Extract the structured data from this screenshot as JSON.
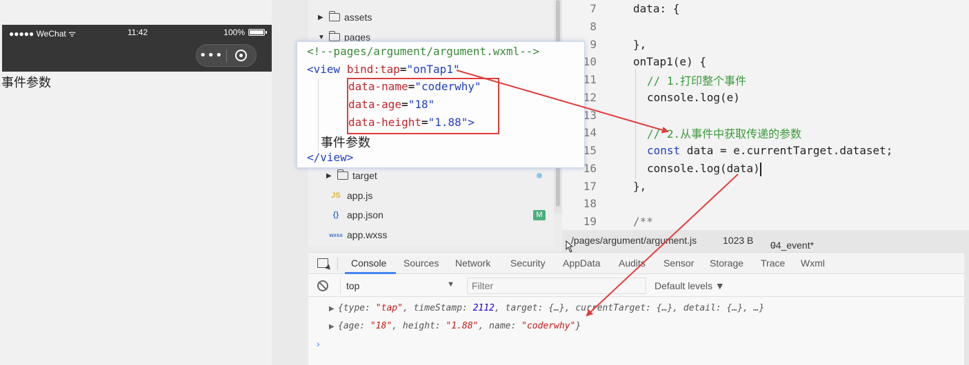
{
  "simulator": {
    "carrier": "●●●●● WeChat",
    "wifi_icon": "wifi-icon",
    "time": "11:42",
    "battery": "100%",
    "capsule_more": "•••",
    "page_text": "事件参数"
  },
  "file_tree": {
    "items": [
      {
        "type": "folder",
        "label": "assets",
        "expanded": false
      },
      {
        "type": "folder",
        "label": "pages",
        "expanded": true
      },
      {
        "type": "folder",
        "label": "target",
        "expanded": false
      },
      {
        "type": "js",
        "icon": "JS",
        "label": "app.js"
      },
      {
        "type": "json",
        "icon": "{}",
        "label": "app.json",
        "badge": "M"
      },
      {
        "type": "wxss",
        "icon": "wxss",
        "label": "app.wxss"
      }
    ]
  },
  "editor": {
    "lines": [
      {
        "n": "7",
        "code": "data: {"
      },
      {
        "n": "8",
        "code": ""
      },
      {
        "n": "9",
        "code": "},"
      },
      {
        "n": "10",
        "code": "onTap1(e) {"
      },
      {
        "n": "11",
        "code": "// 1.打印整个事件"
      },
      {
        "n": "12",
        "code": "console.log(e)"
      },
      {
        "n": "13",
        "code": ""
      },
      {
        "n": "14",
        "code": "// 2.从事件中获取传递的参数"
      },
      {
        "n": "15",
        "code_kw": "const",
        "code": " data = e.currentTarget.dataset;"
      },
      {
        "n": "16",
        "code": "console.log(data)"
      },
      {
        "n": "17",
        "code": "},"
      },
      {
        "n": "18",
        "code": ""
      },
      {
        "n": "19",
        "code": "/**"
      }
    ]
  },
  "editor_status": {
    "path": "/pages/argument/argument.js",
    "size": "1023 B",
    "branch": "04_event*"
  },
  "wxml_popup": {
    "comment": "<!--pages/argument/argument.wxml-->",
    "view_open": "<view",
    "bind_attr": "bind:tap",
    "bind_value": "\"onTap1\"",
    "attr1_name": "data-name",
    "attr1_value": "\"coderwhy\"",
    "attr2_name": "data-age",
    "attr2_value": "\"18\"",
    "attr3_name": "data-height",
    "attr3_value": "\"1.88\"",
    "tag_close_bracket": ">",
    "text": "事件参数",
    "view_close": "</view>"
  },
  "devtools": {
    "tabs": [
      "Console",
      "Sources",
      "Network",
      "Security",
      "AppData",
      "Audits",
      "Sensor",
      "Storage",
      "Trace",
      "Wxml"
    ],
    "active_tab": "Console",
    "context": "top",
    "filter_placeholder": "Filter",
    "levels": "Default levels ▼",
    "logs": [
      {
        "text_parts": [
          "{type: ",
          "\"tap\"",
          ", timeStamp: ",
          "2112",
          ", target: {…}, currentTarget: {…}, detail: {…}, …}"
        ]
      },
      {
        "text_parts": [
          "{age: ",
          "\"18\"",
          ", height: ",
          "\"1.88\"",
          ", name: ",
          "\"coderwhy\"",
          "}"
        ]
      }
    ],
    "prompt": "›"
  },
  "colors": {
    "accent": "#4285f4",
    "annotation_red": "#e23c3c",
    "comment_green": "#3a9a3a",
    "keyword_blue": "#1f3fc0"
  }
}
